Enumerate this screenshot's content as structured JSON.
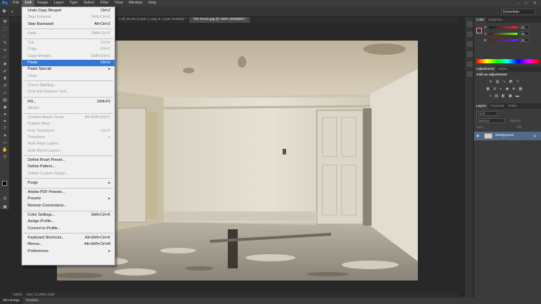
{
  "menubar": {
    "logo": "Ps",
    "items": [
      "File",
      "Edit",
      "Image",
      "Layer",
      "Type",
      "Select",
      "Filter",
      "View",
      "Window",
      "Help"
    ],
    "window_controls": [
      "–",
      "□",
      "✕"
    ]
  },
  "optbar": {
    "workspace": "Essentials"
  },
  "tabs": [
    "1 @ 33.3% (Layer 1 copy 8, Layer Mask/8) *",
    "The Room.jpg @ 100% (RGB/8#) *"
  ],
  "edit_menu": {
    "items": [
      {
        "label": "Undo Copy Merged",
        "shortcut": "Ctrl+Z",
        "state": "enabled"
      },
      {
        "label": "Step Forward",
        "shortcut": "Shift+Ctrl+Z",
        "state": "disabled"
      },
      {
        "label": "Step Backward",
        "shortcut": "Alt+Ctrl+Z",
        "state": "enabled"
      },
      {
        "sep": true
      },
      {
        "label": "Fade...",
        "shortcut": "Shift+Ctrl+F",
        "state": "disabled"
      },
      {
        "sep": true
      },
      {
        "label": "Cut",
        "shortcut": "Ctrl+X",
        "state": "disabled"
      },
      {
        "label": "Copy",
        "shortcut": "Ctrl+C",
        "state": "disabled"
      },
      {
        "label": "Copy Merged",
        "shortcut": "Shift+Ctrl+C",
        "state": "disabled"
      },
      {
        "label": "Paste",
        "shortcut": "Ctrl+V",
        "state": "highlight"
      },
      {
        "label": "Paste Special",
        "shortcut": "",
        "state": "enabled",
        "submenu": true
      },
      {
        "label": "Clear",
        "shortcut": "",
        "state": "disabled"
      },
      {
        "sep": true
      },
      {
        "label": "Check Spelling...",
        "shortcut": "",
        "state": "disabled"
      },
      {
        "label": "Find and Replace Text...",
        "shortcut": "",
        "state": "disabled"
      },
      {
        "sep": true
      },
      {
        "label": "Fill...",
        "shortcut": "Shift+F5",
        "state": "enabled"
      },
      {
        "label": "Stroke...",
        "shortcut": "",
        "state": "disabled"
      },
      {
        "sep": true
      },
      {
        "label": "Content-Aware Scale",
        "shortcut": "Alt+Shift+Ctrl+C",
        "state": "disabled"
      },
      {
        "label": "Puppet Warp",
        "shortcut": "",
        "state": "disabled"
      },
      {
        "label": "Free Transform",
        "shortcut": "Ctrl+T",
        "state": "disabled"
      },
      {
        "label": "Transform",
        "shortcut": "",
        "state": "disabled",
        "submenu": true
      },
      {
        "label": "Auto-Align Layers...",
        "shortcut": "",
        "state": "disabled"
      },
      {
        "label": "Auto-Blend Layers...",
        "shortcut": "",
        "state": "disabled"
      },
      {
        "sep": true
      },
      {
        "label": "Define Brush Preset...",
        "shortcut": "",
        "state": "enabled"
      },
      {
        "label": "Define Pattern...",
        "shortcut": "",
        "state": "enabled"
      },
      {
        "label": "Define Custom Shape...",
        "shortcut": "",
        "state": "disabled"
      },
      {
        "sep": true
      },
      {
        "label": "Purge",
        "shortcut": "",
        "state": "enabled",
        "submenu": true
      },
      {
        "sep": true
      },
      {
        "label": "Adobe PDF Presets...",
        "shortcut": "",
        "state": "enabled"
      },
      {
        "label": "Presets",
        "shortcut": "",
        "state": "enabled",
        "submenu": true
      },
      {
        "label": "Remote Connections...",
        "shortcut": "",
        "state": "enabled"
      },
      {
        "sep": true
      },
      {
        "label": "Color Settings...",
        "shortcut": "Shift+Ctrl+K",
        "state": "enabled"
      },
      {
        "label": "Assign Profile...",
        "shortcut": "",
        "state": "enabled"
      },
      {
        "label": "Convert to Profile...",
        "shortcut": "",
        "state": "enabled"
      },
      {
        "sep": true
      },
      {
        "label": "Keyboard Shortcuts...",
        "shortcut": "Alt+Shift+Ctrl+K",
        "state": "enabled"
      },
      {
        "label": "Menus...",
        "shortcut": "Alt+Shift+Ctrl+M",
        "state": "enabled"
      },
      {
        "label": "Preferences",
        "shortcut": "",
        "state": "enabled",
        "submenu": true
      }
    ]
  },
  "status": {
    "zoom": "100%",
    "doc": "Doc: 3.13M/3.13M"
  },
  "bottom_tabs": [
    "Mini Bridge",
    "Timeline"
  ],
  "color_panel": {
    "tabs": [
      "Color",
      "Swatches"
    ],
    "sliders": [
      {
        "label": "R",
        "value": "98"
      },
      {
        "label": "G",
        "value": "38"
      },
      {
        "label": "B",
        "value": "35"
      }
    ]
  },
  "adjustments_panel": {
    "tabs": [
      "Adjustments",
      "Styles"
    ],
    "heading": "Add an adjustment"
  },
  "layers_panel": {
    "tabs": [
      "Layers",
      "Channels",
      "Paths"
    ],
    "kind": "Kind",
    "blend_mode": "Normal",
    "opacity_label": "Opacity:",
    "lock_label": "Lock:",
    "fill_label": "Fill:",
    "layer_name": "Background"
  },
  "colors": {
    "highlight": "#3478d6",
    "ps_blue": "#3fa2f5"
  }
}
